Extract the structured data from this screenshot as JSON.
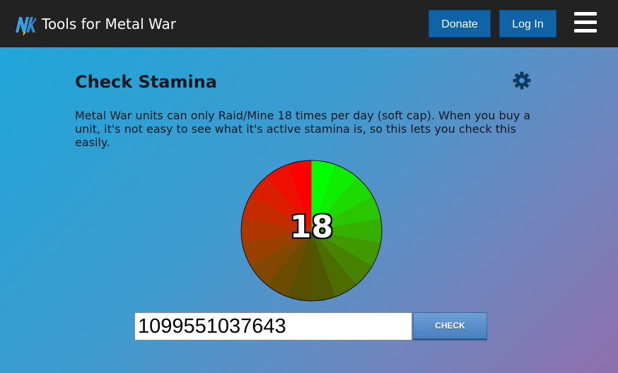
{
  "header": {
    "logo_icon": "nk-logo-icon",
    "title": "Tools for Metal War",
    "donate_label": "Donate",
    "login_label": "Log In",
    "menu_icon": "hamburger-menu-icon"
  },
  "main": {
    "title": "Check Stamina",
    "settings_icon": "gear-icon",
    "description": "Metal War units can only Raid/Mine 18 times per day (soft cap). When you buy a unit, it's not easy to see what it's active stamina is, so this lets you check this easily."
  },
  "stamina": {
    "value": "18",
    "max": 18,
    "segments": 18,
    "start_color": "#ff0000",
    "end_color": "#00ff00"
  },
  "form": {
    "unit_id_value": "1099551037643",
    "check_label": "CHECK"
  },
  "colors": {
    "topbar": "#222222",
    "button_blue": "#0f63a6"
  }
}
